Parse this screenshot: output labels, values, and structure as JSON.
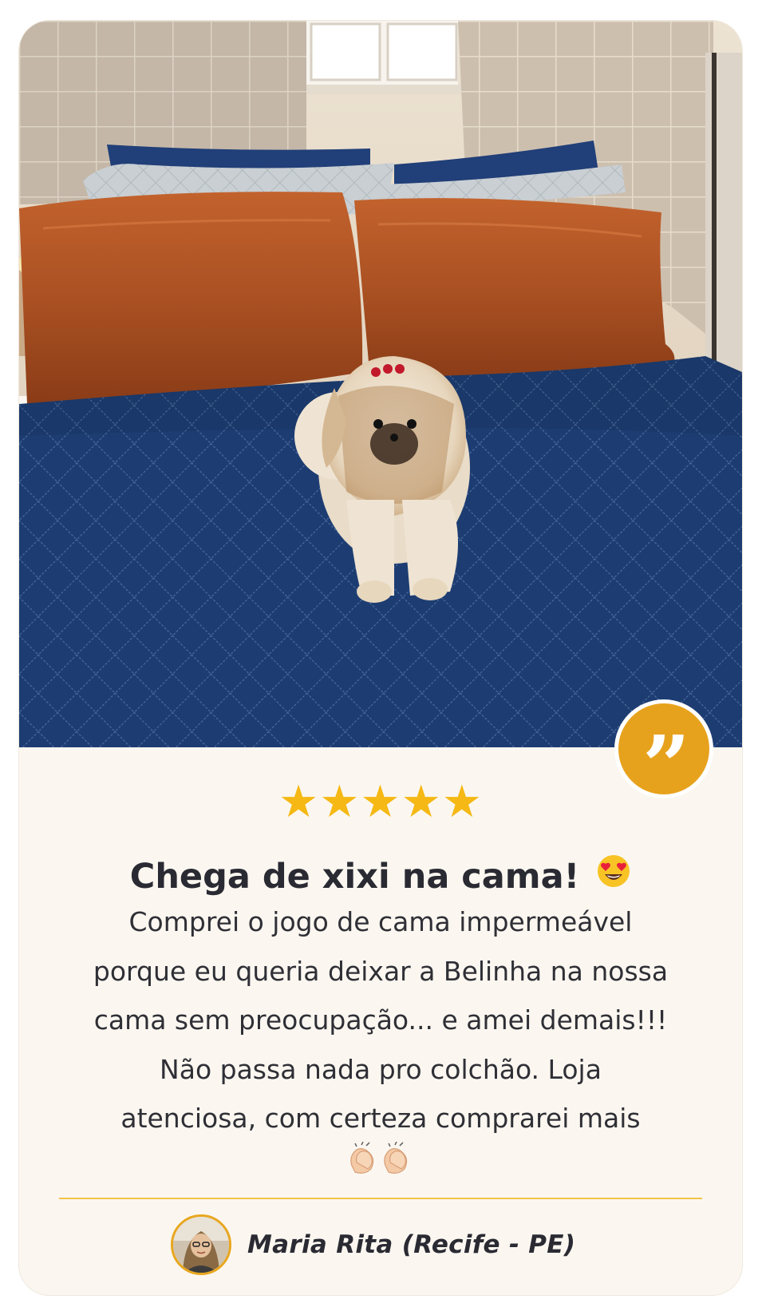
{
  "review_card": {
    "photo_alt": "",
    "rating": {
      "stars": "★★★★★",
      "value": 5,
      "max": 5,
      "color": "#f5b814"
    },
    "title": "Chega de xixi na cama!",
    "title_emoji_icon": "heart-eyes-emoji-icon",
    "text": "Comprei o jogo de cama impermeável porque eu queria deixar a Belinha na nossa cama sem preocupação... e amei demais!!! Não passa nada pro colchão. Loja atenciosa, com certeza comprarei mais",
    "text_emoji_icon": "clapping-hands-emoji-icon",
    "author": "Maria Rita (Recife - PE)",
    "quote_icon": "quote-icon",
    "colors": {
      "accent": "#e7a21d",
      "card_background": "#fbf7f0",
      "text": "#2a2a33",
      "divider": "#f2c24a"
    }
  }
}
